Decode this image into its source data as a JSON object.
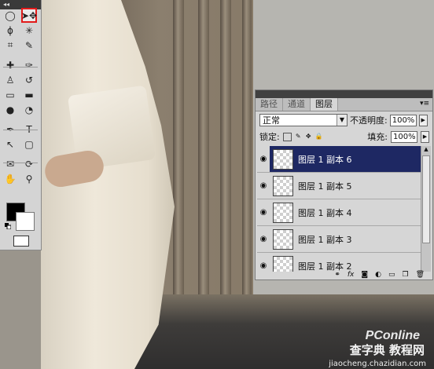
{
  "toolbox": {
    "collapse": "◂◂",
    "tools": [
      {
        "name": "marquee-tool",
        "glyph": "◯"
      },
      {
        "name": "move-tool",
        "glyph": "➤✥"
      },
      {
        "name": "lasso-tool",
        "glyph": "ϕ"
      },
      {
        "name": "magic-wand-tool",
        "glyph": "✳"
      },
      {
        "name": "crop-tool",
        "glyph": "⌗"
      },
      {
        "name": "eyedropper-tool",
        "glyph": "✎"
      },
      {
        "name": "healing-tool",
        "glyph": "✚"
      },
      {
        "name": "brush-tool",
        "glyph": "✑"
      },
      {
        "name": "stamp-tool",
        "glyph": "♙"
      },
      {
        "name": "history-brush-tool",
        "glyph": "↺"
      },
      {
        "name": "eraser-tool",
        "glyph": "▭"
      },
      {
        "name": "gradient-tool",
        "glyph": "▬"
      },
      {
        "name": "blur-tool",
        "glyph": "●"
      },
      {
        "name": "dodge-tool",
        "glyph": "◔"
      },
      {
        "name": "pen-tool",
        "glyph": "✒"
      },
      {
        "name": "type-tool",
        "glyph": "T"
      },
      {
        "name": "path-select-tool",
        "glyph": "↖"
      },
      {
        "name": "shape-tool",
        "glyph": "▢"
      },
      {
        "name": "notes-tool",
        "glyph": "✉"
      },
      {
        "name": "3d-tool",
        "glyph": "⟳"
      },
      {
        "name": "hand-tool",
        "glyph": "✋"
      },
      {
        "name": "zoom-tool",
        "glyph": "⚲"
      }
    ]
  },
  "layers_panel": {
    "tabs": [
      "路径",
      "通道",
      "图层"
    ],
    "active_tab": "图层",
    "blend_mode": "正常",
    "opacity_label": "不透明度:",
    "opacity_value": "100%",
    "lock_label": "锁定:",
    "fill_label": "填充:",
    "fill_value": "100%",
    "layers": [
      {
        "name": "图层 1 副本 6",
        "active": true
      },
      {
        "name": "图层 1 副本 5",
        "active": false
      },
      {
        "name": "图层 1 副本 4",
        "active": false
      },
      {
        "name": "图层 1 副本 3",
        "active": false
      },
      {
        "name": "图层 1 副本 2",
        "active": false
      }
    ],
    "footer_icons": [
      "link-icon",
      "fx-icon",
      "mask-icon",
      "adjustment-icon",
      "group-icon",
      "new-layer-icon",
      "trash-icon"
    ]
  },
  "watermark": {
    "brand": "PConline",
    "site_cn": "查字典 教程网",
    "site_url": "jiaocheng.chazidian.com"
  }
}
